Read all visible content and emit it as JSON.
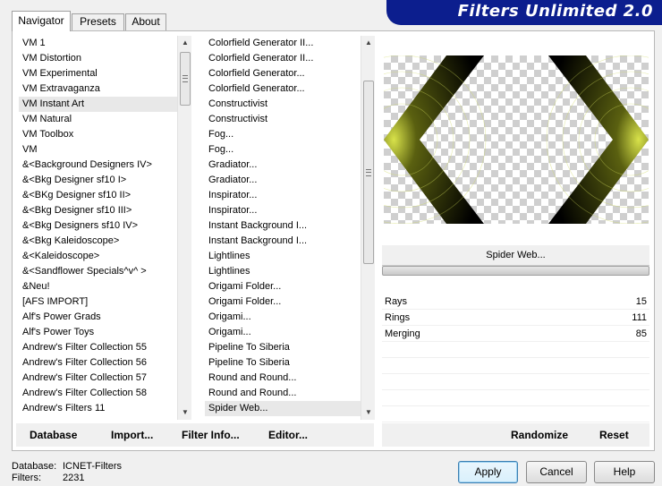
{
  "banner": {
    "title": "Filters Unlimited 2.0"
  },
  "tabs": [
    {
      "label": "Navigator",
      "active": true
    },
    {
      "label": "Presets",
      "active": false
    },
    {
      "label": "About",
      "active": false
    }
  ],
  "categories": {
    "selected": "VM Instant Art",
    "items": [
      "VM 1",
      "VM Distortion",
      "VM Experimental",
      "VM Extravaganza",
      "VM Instant Art",
      "VM Natural",
      "VM Toolbox",
      "VM",
      "&<Background Designers IV>",
      "&<Bkg Designer sf10 I>",
      "&<BKg Designer sf10 II>",
      "&<Bkg Designer sf10 III>",
      "&<Bkg Designers sf10 IV>",
      "&<Bkg Kaleidoscope>",
      "&<Kaleidoscope>",
      "&<Sandflower Specials^v^ >",
      "&Neu!",
      "[AFS IMPORT]",
      "Alf's Power Grads",
      "Alf's Power Toys",
      "Andrew's Filter Collection 55",
      "Andrew's Filter Collection 56",
      "Andrew's Filter Collection 57",
      "Andrew's Filter Collection 58",
      "Andrew's Filters 11"
    ]
  },
  "filters": {
    "selected": "Spider Web...",
    "items": [
      "Colorfield Generator II...",
      "Colorfield Generator II...",
      "Colorfield Generator...",
      "Colorfield Generator...",
      "Constructivist",
      "Constructivist",
      "Fog...",
      "Fog...",
      "Gradiator...",
      "Gradiator...",
      "Inspirator...",
      "Inspirator...",
      "Instant Background I...",
      "Instant Background I...",
      "Lightlines",
      "Lightlines",
      "Origami Folder...",
      "Origami Folder...",
      "Origami...",
      "Origami...",
      "Pipeline To Siberia",
      "Pipeline To Siberia",
      "Round and Round...",
      "Round and Round...",
      "Spider Web..."
    ]
  },
  "preview": {
    "preset_label": "Spider Web..."
  },
  "params": [
    {
      "name": "Rays",
      "value": "15"
    },
    {
      "name": "Rings",
      "value": "111"
    },
    {
      "name": "Merging",
      "value": "85"
    }
  ],
  "links": {
    "database": "Database",
    "import": "Import...",
    "filter_info": "Filter Info...",
    "editor": "Editor...",
    "randomize": "Randomize",
    "reset": "Reset"
  },
  "status": {
    "database_label": "Database:",
    "database_value": "ICNET-Filters",
    "filters_label": "Filters:",
    "filters_value": "2231"
  },
  "buttons": {
    "apply": "Apply",
    "cancel": "Cancel",
    "help": "Help"
  },
  "colors": {
    "banner_bg": "#0c1e8e",
    "effect_yellow": "#d8e24a"
  }
}
